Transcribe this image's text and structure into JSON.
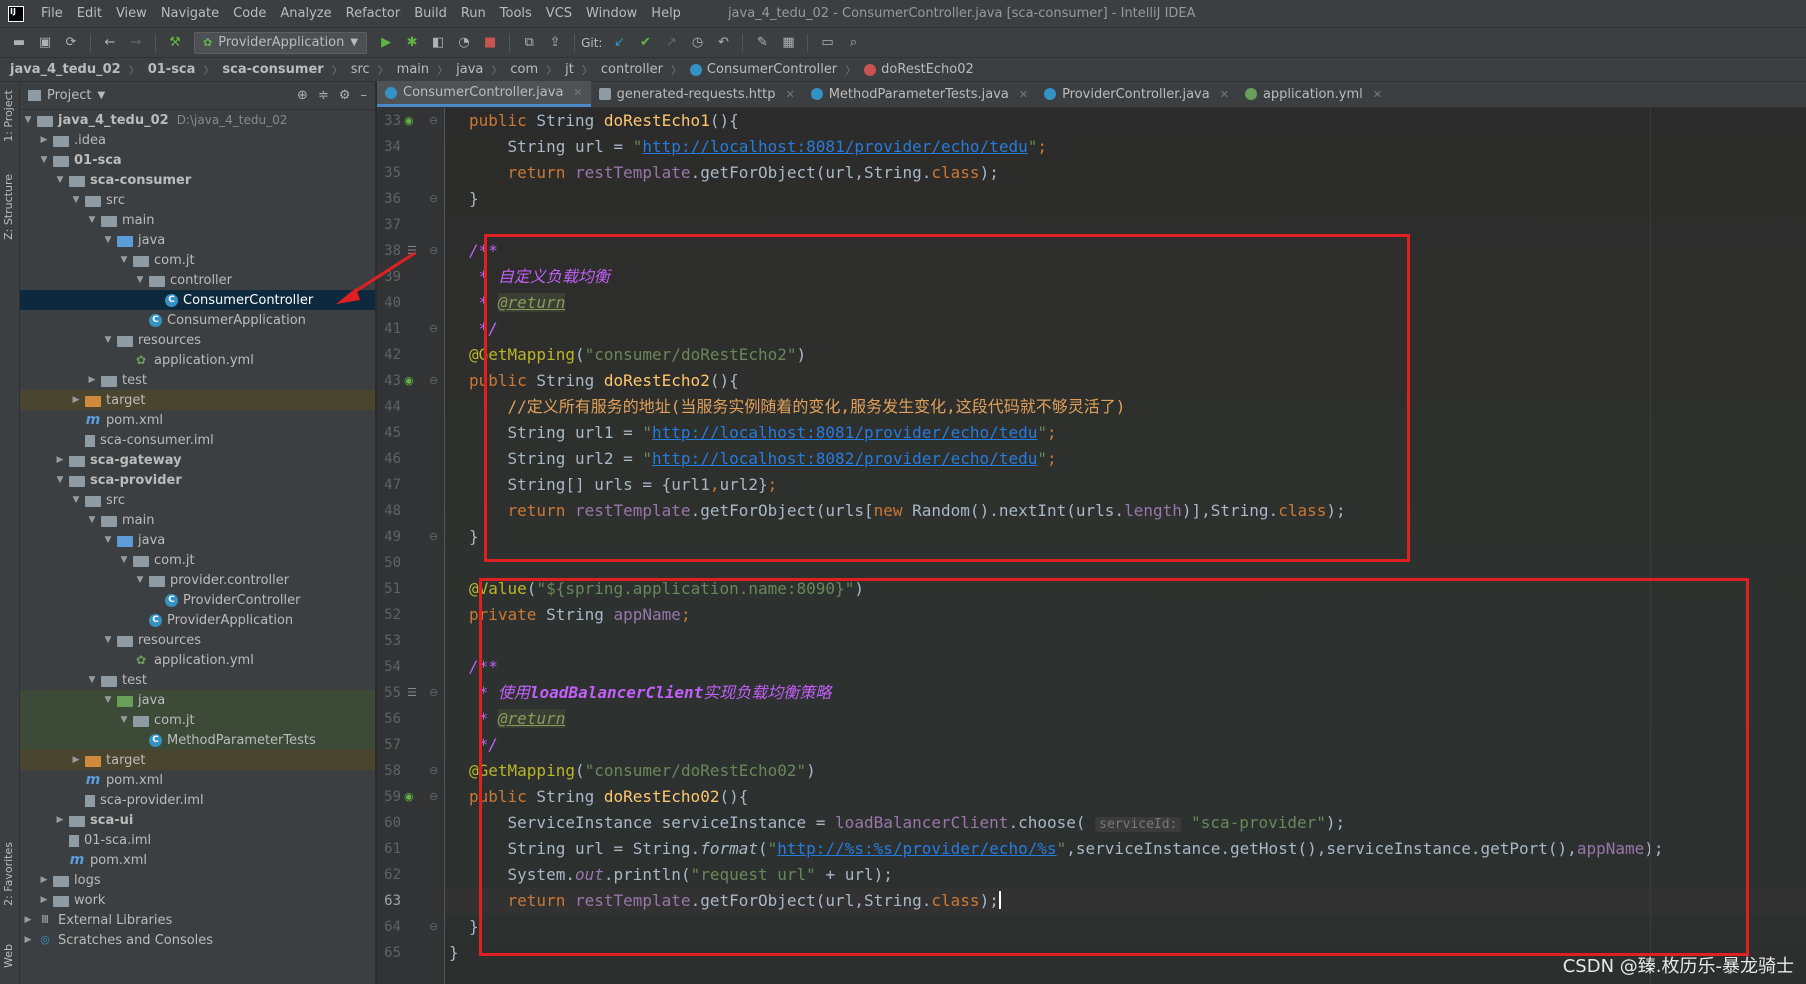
{
  "window_title": "java_4_tedu_02 - ConsumerController.java [sca-consumer] - IntelliJ IDEA",
  "menu": [
    "File",
    "Edit",
    "View",
    "Navigate",
    "Code",
    "Analyze",
    "Refactor",
    "Build",
    "Run",
    "Tools",
    "VCS",
    "Window",
    "Help"
  ],
  "toolbar": {
    "run_config": "ProviderApplication",
    "git_label": "Git:"
  },
  "breadcrumb": [
    "java_4_tedu_02",
    "01-sca",
    "sca-consumer",
    "src",
    "main",
    "java",
    "com",
    "jt",
    "controller",
    "ConsumerController",
    "doRestEcho02"
  ],
  "left_strip": {
    "project_tab": "1: Project",
    "structure_tab": "Z: Structure",
    "favorites_tab": "2: Favorites",
    "web_tab": "Web"
  },
  "project_panel": {
    "title": "Project",
    "tree": [
      {
        "label": "java_4_tedu_02",
        "path": "D:\\java_4_tedu_02"
      },
      {
        "label": ".idea"
      },
      {
        "label": "01-sca"
      },
      {
        "label": "sca-consumer"
      },
      {
        "label": "src"
      },
      {
        "label": "main"
      },
      {
        "label": "java"
      },
      {
        "label": "com.jt"
      },
      {
        "label": "controller"
      },
      {
        "label": "ConsumerController"
      },
      {
        "label": "ConsumerApplication"
      },
      {
        "label": "resources"
      },
      {
        "label": "application.yml"
      },
      {
        "label": "test"
      },
      {
        "label": "target"
      },
      {
        "label": "pom.xml"
      },
      {
        "label": "sca-consumer.iml"
      },
      {
        "label": "sca-gateway"
      },
      {
        "label": "sca-provider"
      },
      {
        "label": "src"
      },
      {
        "label": "main"
      },
      {
        "label": "java"
      },
      {
        "label": "com.jt"
      },
      {
        "label": "provider.controller"
      },
      {
        "label": "ProviderController"
      },
      {
        "label": "ProviderApplication"
      },
      {
        "label": "resources"
      },
      {
        "label": "application.yml"
      },
      {
        "label": "test"
      },
      {
        "label": "java"
      },
      {
        "label": "com.jt"
      },
      {
        "label": "MethodParameterTests"
      },
      {
        "label": "target"
      },
      {
        "label": "pom.xml"
      },
      {
        "label": "sca-provider.iml"
      },
      {
        "label": "sca-ui"
      },
      {
        "label": "01-sca.iml"
      },
      {
        "label": "pom.xml"
      },
      {
        "label": "logs"
      },
      {
        "label": "work"
      },
      {
        "label": "External Libraries"
      },
      {
        "label": "Scratches and Consoles"
      }
    ]
  },
  "tabs": [
    {
      "label": "ConsumerController.java",
      "active": true
    },
    {
      "label": "generated-requests.http"
    },
    {
      "label": "MethodParameterTests.java"
    },
    {
      "label": "ProviderController.java"
    },
    {
      "label": "application.yml"
    }
  ],
  "editor": {
    "line_numbers": [
      "33",
      "34",
      "35",
      "36",
      "37",
      "38",
      "39",
      "40",
      "41",
      "42",
      "43",
      "44",
      "45",
      "46",
      "47",
      "48",
      "49",
      "50",
      "51",
      "52",
      "53",
      "54",
      "55",
      "56",
      "57",
      "58",
      "59",
      "60",
      "61",
      "62",
      "63",
      "64",
      "65"
    ],
    "code": {
      "l33_kw1": "public",
      "l33_rest": " String ",
      "l33_name": "doRestEcho1",
      "l33_end": "(){",
      "l34_pre": "    String url = ",
      "l34_q1": "\"",
      "l34_url": "http://localhost:8081/provider/echo/tedu",
      "l34_q2": "\"",
      "l34_end": ";",
      "l35_kw": "    return ",
      "l35_obj": "restTemplate",
      "l35_mid": ".getForObject(url,String.",
      "l35_cls": "class",
      "l35_end": ");",
      "l36": "}",
      "l38": "/**",
      "l39": " * 自定义负载均衡",
      "l40_pre": " * ",
      "l40_tag": "@return",
      "l41": " */",
      "l42_ann": "@GetMapping",
      "l42_open": "(",
      "l42_str": "\"consumer/doRestEcho2\"",
      "l42_close": ")",
      "l43_kw": "public",
      "l43_rest": " String ",
      "l43_name": "doRestEcho2",
      "l43_end": "(){",
      "l44": "    //定义所有服务的地址(当服务实例随着的变化,服务发生变化,这段代码就不够灵活了)",
      "l45_pre": "    String url1 = ",
      "l45_q1": "\"",
      "l45_url": "http://localhost:8081/provider/echo/tedu",
      "l45_q2": "\"",
      "l45_end": ";",
      "l46_pre": "    String url2 = ",
      "l46_q1": "\"",
      "l46_url": "http://localhost:8082/provider/echo/tedu",
      "l46_q2": "\"",
      "l46_end": ";",
      "l47_pre": "    String[] urls = {url1",
      "l47_comma": ",",
      "l47_mid": "url2}",
      "l47_end": ";",
      "l48_kw": "    return ",
      "l48_obj": "restTemplate",
      "l48_a": ".getForObject(urls[",
      "l48_new": "new",
      "l48_b": " Random().nextInt(urls.",
      "l48_len": "length",
      "l48_c": ")],String.",
      "l48_cls": "class",
      "l48_end": ");",
      "l49": "}",
      "l51_ann": "@Value",
      "l51_open": "(",
      "l51_str": "\"${spring.application.name:8090}\"",
      "l51_close": ")",
      "l52_kw": "private",
      "l52_rest": " String ",
      "l52_field": "appName",
      "l52_end": ";",
      "l54": "/**",
      "l55_a": " * 使用",
      "l55_b": "loadBalancerClient",
      "l55_c": "实现负载均衡策略",
      "l56_pre": " * ",
      "l56_tag": "@return",
      "l57": " */",
      "l58_ann": "@GetMapping",
      "l58_open": "(",
      "l58_str": "\"consumer/doRestEcho02\"",
      "l58_close": ")",
      "l59_kw": "public",
      "l59_rest": " String ",
      "l59_name": "doRestEcho02",
      "l59_end": "(){",
      "l60_pre": "    ServiceInstance serviceInstance = ",
      "l60_obj": "loadBalancerClient",
      "l60_mid": ".choose( ",
      "l60_hint": "serviceId:",
      "l60_str": " \"sca-provider\"",
      "l60_end": ");",
      "l61_pre": "    String url = String.",
      "l61_fmt": "format",
      "l61_open": "(",
      "l61_q1": "\"",
      "l61_url": "http://%s:%s/provider/echo/%s",
      "l61_q2": "\"",
      "l61_mid": ",serviceInstance.getHost(),serviceInstance.getPort(),",
      "l61_field": "appName",
      "l61_end": ");",
      "l62_pre": "    System.",
      "l62_out": "out",
      "l62_mid": ".println(",
      "l62_str": "\"request url\"",
      "l62_end": " + url);",
      "l63_kw": "    return ",
      "l63_obj": "restTemplate",
      "l63_mid": ".getForObject(url,String.",
      "l63_cls": "class",
      "l63_end": ");",
      "l64": "}",
      "l65": "}"
    }
  },
  "watermark": "CSDN @臻.枚历乐-暴龙骑士",
  "colors": {
    "highlight_box": "#e02020",
    "keyword": "#cc7832",
    "string": "#6a8759",
    "annotation": "#bbb529"
  }
}
